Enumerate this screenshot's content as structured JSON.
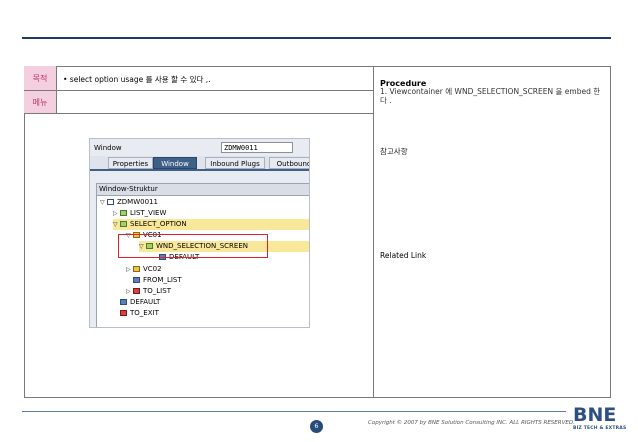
{
  "table": {
    "row1_label": "목적",
    "row1_text": "• select option usage 를 사용 할 수 있다 ,.",
    "row2_label": "메뉴",
    "row2_text": ""
  },
  "right": {
    "procedure_title": "Procedure",
    "procedure_text": "1. Viewcontainer 에 WND_SELECTION_SCREEN 을 embed 한다 .",
    "reference_label": "참고사항",
    "related_link_label": "Related Link"
  },
  "sap": {
    "window_label": "Window",
    "window_value": "ZDMW0011",
    "tabs": [
      "Properties",
      "Window",
      "Inbound Plugs",
      "Outbound"
    ],
    "active_tab": "Window",
    "tree_header": "Window-Struktur",
    "nodes": [
      {
        "label": "ZDMW0011"
      },
      {
        "label": "LIST_VIEW"
      },
      {
        "label": "SELECT_OPTION"
      },
      {
        "label": "VC01"
      },
      {
        "label": "WND_SELECTION_SCREEN"
      },
      {
        "label": "DEFAULT"
      },
      {
        "label": "VC02"
      },
      {
        "label": "FROM_LIST"
      },
      {
        "label": "TO_LIST"
      },
      {
        "label": "DEFAULT"
      },
      {
        "label": "TO_EXIT"
      }
    ]
  },
  "footer": {
    "page_number": "6",
    "copyright": "Copyright © 2007 by BNE Solution Consulting INC.   ALL RIGHTS RESERVED.",
    "logo_text": "BNE",
    "logo_subtext": "BIZ TECH & EXTRAS"
  },
  "colors": {
    "label_bg": "#f3cfe0",
    "label_text": "#c0306b",
    "accent_navy": "#1f3b63",
    "highlight": "#f9e79a",
    "annotation_red": "#e0202a"
  }
}
